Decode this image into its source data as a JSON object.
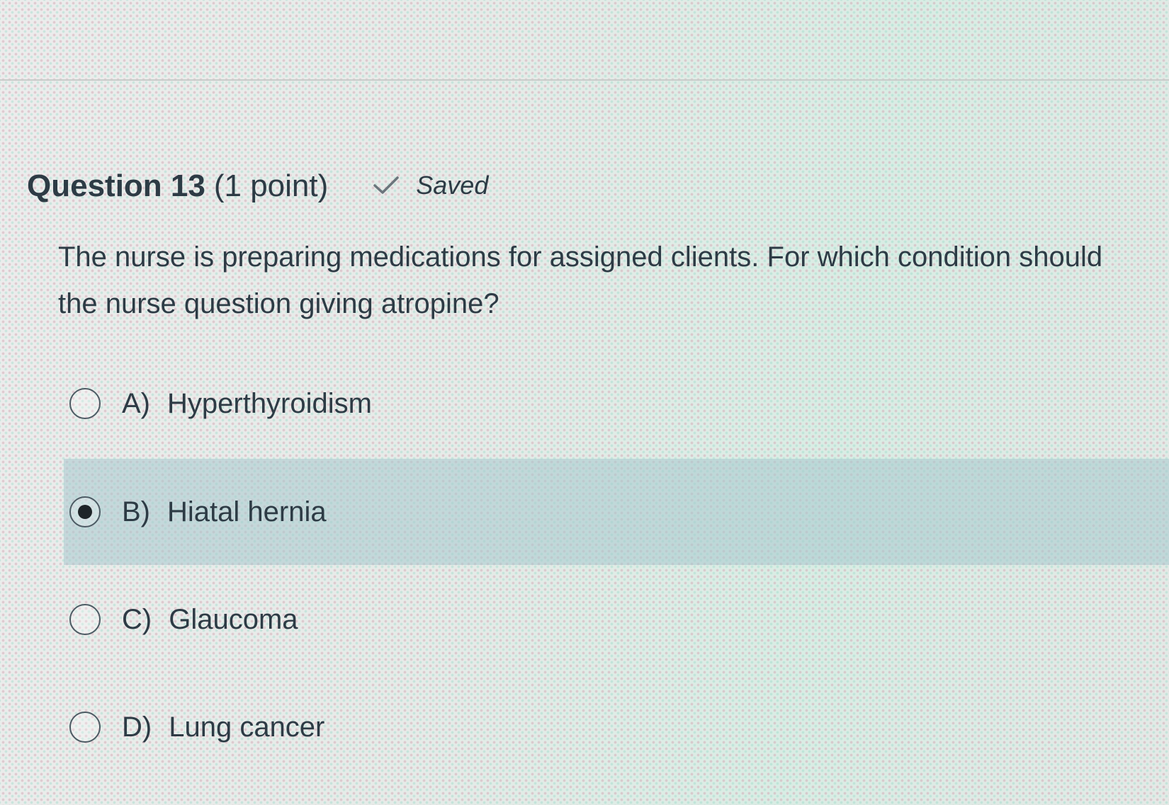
{
  "question": {
    "title": "Question 13",
    "points": "(1 point)",
    "status": "Saved",
    "text_line1": "The nurse is preparing medications for assigned clients. For which condition should",
    "text_line2": "the nurse question giving atropine?"
  },
  "options": [
    {
      "letter": "A)",
      "label": "Hyperthyroidism",
      "selected": false
    },
    {
      "letter": "B)",
      "label": "Hiatal hernia",
      "selected": true
    },
    {
      "letter": "C)",
      "label": "Glaucoma",
      "selected": false
    },
    {
      "letter": "D)",
      "label": "Lung cancer",
      "selected": false
    }
  ],
  "icons": {
    "status": "checkmark-icon",
    "radio": "radio-button-icon"
  },
  "colors": {
    "text": "#2d3b45",
    "selected_row": "#a5c8cd"
  }
}
